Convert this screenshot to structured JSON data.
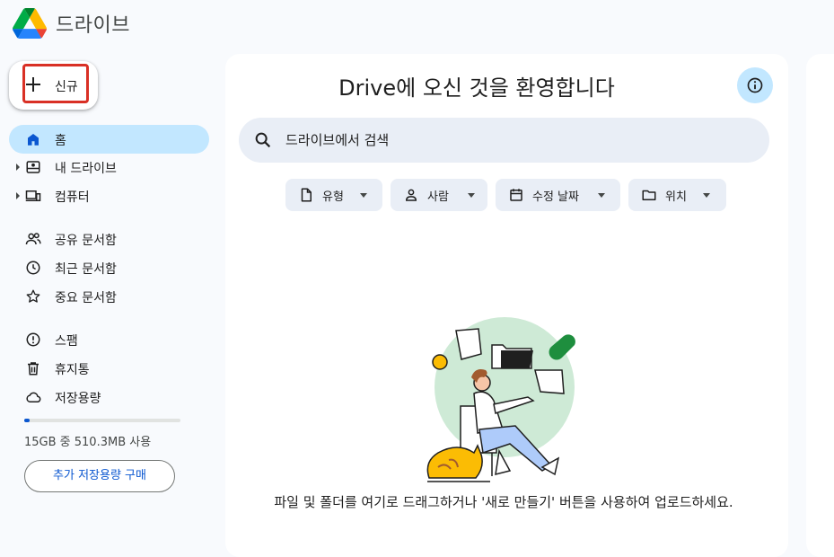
{
  "app": {
    "title": "드라이브"
  },
  "new_button": {
    "label": "신규"
  },
  "sidebar": {
    "items": [
      {
        "label": "홈",
        "icon": "home-icon"
      },
      {
        "label": "내 드라이브",
        "icon": "my-drive-icon"
      },
      {
        "label": "컴퓨터",
        "icon": "computers-icon"
      },
      {
        "label": "공유 문서함",
        "icon": "shared-icon"
      },
      {
        "label": "최근 문서함",
        "icon": "clock-icon"
      },
      {
        "label": "중요 문서함",
        "icon": "star-icon"
      },
      {
        "label": "스팸",
        "icon": "spam-icon"
      },
      {
        "label": "휴지통",
        "icon": "trash-icon"
      },
      {
        "label": "저장용량",
        "icon": "cloud-icon"
      }
    ],
    "storage": {
      "text": "15GB 중 510.3MB 사용",
      "used_fraction": 0.034
    },
    "buy_storage_label": "추가 저장용량 구매"
  },
  "main": {
    "title": "Drive에 오신 것을 환영합니다",
    "search": {
      "placeholder": "드라이브에서 검색"
    },
    "filters": [
      {
        "label": "유형",
        "icon": "file-icon"
      },
      {
        "label": "사람",
        "icon": "person-icon"
      },
      {
        "label": "수정 날짜",
        "icon": "calendar-icon"
      },
      {
        "label": "위치",
        "icon": "folder-icon"
      }
    ],
    "empty_state_text": "파일 및 폴더를 여기로 드래그하거나 '새로 만들기' 버튼을 사용하여 업로드하세요."
  },
  "colors": {
    "accent": "#0b57d0",
    "active_nav": "#c2e7ff",
    "chip_bg": "#e9eef6",
    "highlight": "#d93025"
  }
}
